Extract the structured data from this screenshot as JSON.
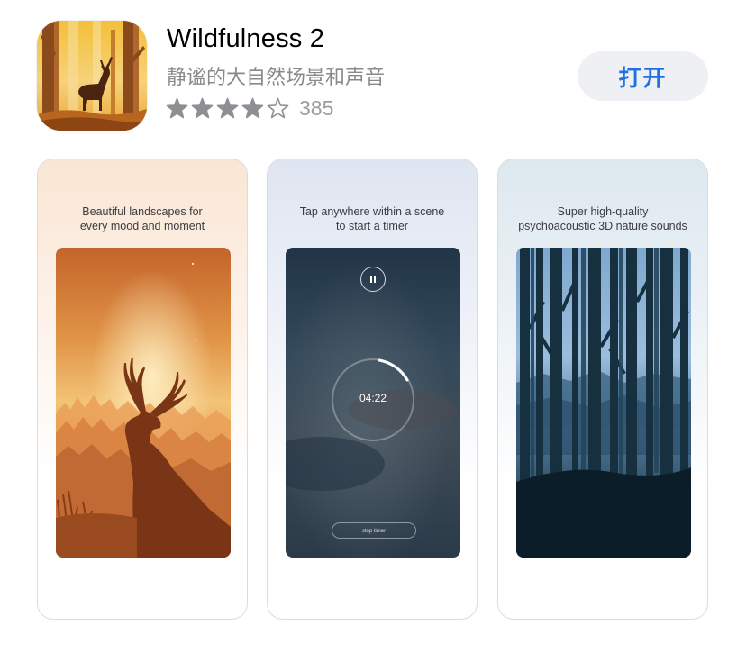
{
  "app": {
    "name": "Wildfulness 2",
    "subtitle": "静谧的大自然场景和声音",
    "rating_stars": 4,
    "rating_count": "385",
    "action_label": "打开",
    "accent_color": "#1f6fe5"
  },
  "screenshots": [
    {
      "caption_line1": "Beautiful landscapes for",
      "caption_line2": "every mood and moment",
      "scene": "deer-sunset"
    },
    {
      "caption_line1": "Tap anywhere within a scene",
      "caption_line2": "to start a timer",
      "scene": "timer",
      "timer_value": "04:22",
      "stop_label": "stop timer"
    },
    {
      "caption_line1": "Super high-quality",
      "caption_line2": "psychoacoustic 3D nature sounds",
      "scene": "blue-forest"
    }
  ]
}
